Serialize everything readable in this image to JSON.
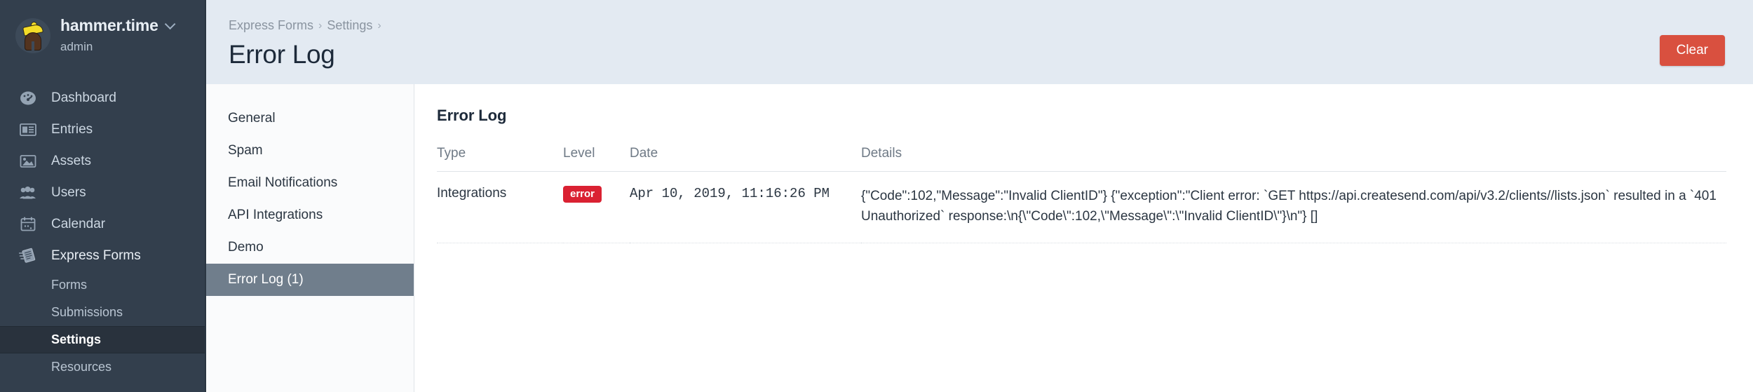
{
  "sidebar": {
    "user": {
      "name": "hammer.time",
      "role": "admin",
      "avatar_icon": "dancing-person-avatar",
      "chevron_icon": "chevron-down-icon"
    },
    "items": [
      {
        "label": "Dashboard",
        "icon": "gauge-icon"
      },
      {
        "label": "Entries",
        "icon": "newspaper-icon"
      },
      {
        "label": "Assets",
        "icon": "image-icon"
      },
      {
        "label": "Users",
        "icon": "users-icon"
      },
      {
        "label": "Calendar",
        "icon": "calendar-icon"
      },
      {
        "label": "Express Forms",
        "icon": "flying-paper-icon"
      }
    ],
    "subitems": [
      {
        "label": "Forms",
        "selected": false
      },
      {
        "label": "Submissions",
        "selected": false
      },
      {
        "label": "Settings",
        "selected": true
      },
      {
        "label": "Resources",
        "selected": false
      }
    ]
  },
  "header": {
    "breadcrumbs": [
      "Express Forms",
      "Settings"
    ],
    "separator": "›",
    "title": "Error Log",
    "clear_label": "Clear",
    "clear_color": "#d9503f"
  },
  "settings_nav": {
    "items": [
      {
        "label": "General",
        "selected": false
      },
      {
        "label": "Spam",
        "selected": false
      },
      {
        "label": "Email Notifications",
        "selected": false
      },
      {
        "label": "API Integrations",
        "selected": false
      },
      {
        "label": "Demo",
        "selected": false
      },
      {
        "label": "Error Log (1)",
        "selected": true
      }
    ],
    "selected_bg": "#707e8c"
  },
  "main": {
    "section_title": "Error Log",
    "columns": [
      "Type",
      "Level",
      "Date",
      "Details"
    ],
    "rows": [
      {
        "type": "Integrations",
        "level": "error",
        "level_color": "#da2132",
        "date": "Apr 10, 2019, 11:16:26 PM",
        "details": "{\"Code\":102,\"Message\":\"Invalid ClientID\"} {\"exception\":\"Client error: `GET https://api.createsend.com/api/v3.2/clients//lists.json` resulted in a `401 Unauthorized` response:\\n{\\\"Code\\\":102,\\\"Message\\\":\\\"Invalid ClientID\\\"}\\n\"} []"
      }
    ]
  }
}
